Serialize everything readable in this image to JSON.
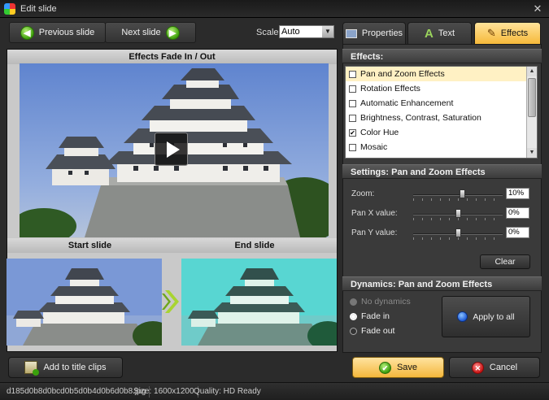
{
  "window": {
    "title": "Edit slide"
  },
  "toolbar": {
    "prev_label": "Previous slide",
    "next_label": "Next slide",
    "scale_label": "Scale:",
    "scale_value": "Auto"
  },
  "preview": {
    "header": "Effects Fade In / Out",
    "start_label": "Start slide",
    "end_label": "End slide"
  },
  "tabs": [
    {
      "label": "Properties",
      "icon": "properties-icon",
      "active": false
    },
    {
      "label": "Text",
      "icon": "text-icon",
      "active": false
    },
    {
      "label": "Effects",
      "icon": "effects-wand-icon",
      "active": true
    }
  ],
  "effects": {
    "header": "Effects:",
    "items": [
      {
        "label": "Pan and Zoom Effects",
        "checked": false,
        "selected": true
      },
      {
        "label": "Rotation Effects",
        "checked": false,
        "selected": false
      },
      {
        "label": "Automatic Enhancement",
        "checked": false,
        "selected": false
      },
      {
        "label": "Brightness, Contrast, Saturation",
        "checked": false,
        "selected": false
      },
      {
        "label": "Color Hue",
        "checked": true,
        "selected": false
      },
      {
        "label": "Mosaic",
        "checked": false,
        "selected": false
      }
    ]
  },
  "settings": {
    "header": "Settings: Pan and Zoom Effects",
    "zoom_label": "Zoom:",
    "zoom_value": "10%",
    "zoom_level": 0.55,
    "panx_label": "Pan X value:",
    "panx_value": "0%",
    "panx_level": 0.5,
    "pany_label": "Pan Y value:",
    "pany_value": "0%",
    "pany_level": 0.5,
    "clear_label": "Clear"
  },
  "dynamics": {
    "header": "Dynamics: Pan and Zoom Effects",
    "options": [
      "No dynamics",
      "Fade in",
      "Fade out"
    ],
    "apply_label": "Apply to all"
  },
  "actions": {
    "add_label": "Add to title clips",
    "save_label": "Save",
    "cancel_label": "Cancel"
  },
  "status": {
    "filename": "d185d0b8d0bcd0b5d0b4d0b6d0b8.jpg",
    "size": "Size: 1600x1200",
    "quality": "Quality: HD Ready"
  },
  "colors": {
    "accent": "#f6b93a",
    "save_button": "#f9c55a",
    "panel_bg": "#3a3a3a"
  }
}
